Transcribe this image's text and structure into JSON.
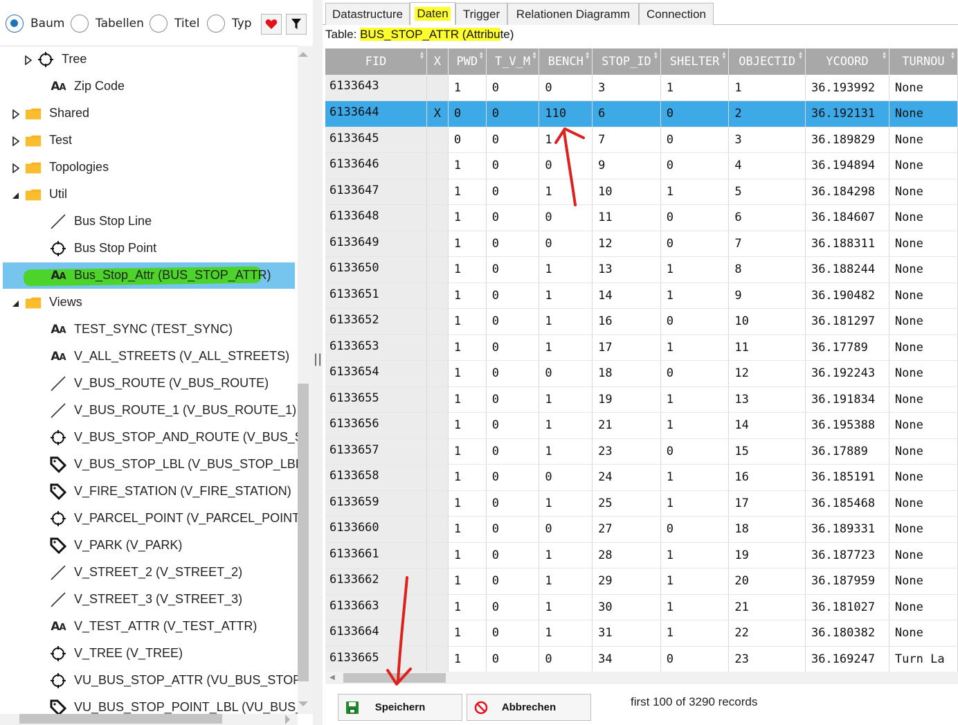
{
  "filter": {
    "radios": [
      {
        "label": "Baum",
        "selected": true
      },
      {
        "label": "Tabellen",
        "selected": false
      },
      {
        "label": "Titel",
        "selected": false
      },
      {
        "label": "Typ",
        "selected": false
      }
    ]
  },
  "tree": {
    "items": [
      {
        "label": "Tree",
        "icon": "crosshair-icon",
        "expander": "collapsed"
      },
      {
        "label": "Zip Code",
        "icon": "attribute-aa-icon",
        "expander": "none"
      },
      {
        "label": "Shared",
        "icon": "folder-icon",
        "expander": "collapsed"
      },
      {
        "label": "Test",
        "icon": "folder-icon",
        "expander": "collapsed"
      },
      {
        "label": "Topologies",
        "icon": "folder-icon",
        "expander": "collapsed"
      },
      {
        "label": "Util",
        "icon": "folder-icon",
        "expander": "expanded"
      },
      {
        "label": "Bus Stop Line",
        "icon": "line-icon",
        "expander": "none"
      },
      {
        "label": "Bus Stop Point",
        "icon": "crosshair-icon",
        "expander": "none"
      },
      {
        "label": "Bus_Stop_Attr (BUS_STOP_ATTR)",
        "icon": "attribute-aa-icon",
        "expander": "none",
        "selected": true
      },
      {
        "label": "Views",
        "icon": "folder-icon",
        "expander": "expanded"
      },
      {
        "label": "TEST_SYNC (TEST_SYNC)",
        "icon": "attribute-aa-icon",
        "expander": "none"
      },
      {
        "label": "V_ALL_STREETS (V_ALL_STREETS)",
        "icon": "attribute-aa-icon",
        "expander": "none"
      },
      {
        "label": "V_BUS_ROUTE (V_BUS_ROUTE)",
        "icon": "line-icon",
        "expander": "none"
      },
      {
        "label": "V_BUS_ROUTE_1 (V_BUS_ROUTE_1)",
        "icon": "line-icon",
        "expander": "none"
      },
      {
        "label": "V_BUS_STOP_AND_ROUTE (V_BUS_STOP_",
        "icon": "crosshair-icon",
        "expander": "none"
      },
      {
        "label": "V_BUS_STOP_LBL (V_BUS_STOP_LBL)",
        "icon": "tag-icon",
        "expander": "none"
      },
      {
        "label": "V_FIRE_STATION (V_FIRE_STATION)",
        "icon": "tag-icon",
        "expander": "none"
      },
      {
        "label": "V_PARCEL_POINT (V_PARCEL_POINT)",
        "icon": "crosshair-icon",
        "expander": "none"
      },
      {
        "label": "V_PARK (V_PARK)",
        "icon": "tag-icon",
        "expander": "none"
      },
      {
        "label": "V_STREET_2 (V_STREET_2)",
        "icon": "line-icon",
        "expander": "none"
      },
      {
        "label": "V_STREET_3 (V_STREET_3)",
        "icon": "line-icon",
        "expander": "none"
      },
      {
        "label": "V_TEST_ATTR (V_TEST_ATTR)",
        "icon": "attribute-aa-icon",
        "expander": "none"
      },
      {
        "label": "V_TREE (V_TREE)",
        "icon": "crosshair-icon",
        "expander": "none"
      },
      {
        "label": "VU_BUS_STOP_ATTR (VU_BUS_STOP_ATT",
        "icon": "crosshair-icon",
        "expander": "none"
      },
      {
        "label": "VU_BUS_STOP_POINT_LBL (VU_BUS_STO",
        "icon": "tag-icon",
        "expander": "none"
      }
    ]
  },
  "tabs": [
    {
      "label": "Datastructure",
      "active": false
    },
    {
      "label": "Daten",
      "active": true
    },
    {
      "label": "Trigger",
      "active": false
    },
    {
      "label": "Relationen Diagramm",
      "active": false
    },
    {
      "label": "Connection",
      "active": false
    }
  ],
  "table_caption": {
    "prefix": "Table: ",
    "highlighted": "BUS_STOP_ATTR (Attribu",
    "suffix": "te)"
  },
  "grid": {
    "columns": [
      "FID",
      "X",
      "PWD",
      "T_V_M",
      "BENCH",
      "STOP_ID",
      "SHELTER",
      "OBJECTID",
      "YCOORD",
      "TURNOU"
    ],
    "rows": [
      [
        "6133643",
        "",
        "1",
        "0",
        "0",
        "3",
        "1",
        "1",
        "36.193992",
        "None"
      ],
      [
        "6133644",
        "X",
        "0",
        "0",
        "110",
        "6",
        "0",
        "2",
        "36.192131",
        "None"
      ],
      [
        "6133645",
        "",
        "0",
        "0",
        "1",
        "7",
        "0",
        "3",
        "36.189829",
        "None"
      ],
      [
        "6133646",
        "",
        "1",
        "0",
        "0",
        "9",
        "0",
        "4",
        "36.194894",
        "None"
      ],
      [
        "6133647",
        "",
        "1",
        "0",
        "1",
        "10",
        "1",
        "5",
        "36.184298",
        "None"
      ],
      [
        "6133648",
        "",
        "1",
        "0",
        "0",
        "11",
        "0",
        "6",
        "36.184607",
        "None"
      ],
      [
        "6133649",
        "",
        "1",
        "0",
        "0",
        "12",
        "0",
        "7",
        "36.188311",
        "None"
      ],
      [
        "6133650",
        "",
        "1",
        "0",
        "1",
        "13",
        "1",
        "8",
        "36.188244",
        "None"
      ],
      [
        "6133651",
        "",
        "1",
        "0",
        "1",
        "14",
        "1",
        "9",
        "36.190482",
        "None"
      ],
      [
        "6133652",
        "",
        "1",
        "0",
        "1",
        "16",
        "0",
        "10",
        "36.181297",
        "None"
      ],
      [
        "6133653",
        "",
        "1",
        "0",
        "1",
        "17",
        "1",
        "11",
        "36.17789",
        "None"
      ],
      [
        "6133654",
        "",
        "1",
        "0",
        "0",
        "18",
        "0",
        "12",
        "36.192243",
        "None"
      ],
      [
        "6133655",
        "",
        "1",
        "0",
        "1",
        "19",
        "1",
        "13",
        "36.191834",
        "None"
      ],
      [
        "6133656",
        "",
        "1",
        "0",
        "1",
        "21",
        "1",
        "14",
        "36.195388",
        "None"
      ],
      [
        "6133657",
        "",
        "1",
        "0",
        "1",
        "23",
        "0",
        "15",
        "36.17889",
        "None"
      ],
      [
        "6133658",
        "",
        "1",
        "0",
        "0",
        "24",
        "1",
        "16",
        "36.185191",
        "None"
      ],
      [
        "6133659",
        "",
        "1",
        "0",
        "1",
        "25",
        "1",
        "17",
        "36.185468",
        "None"
      ],
      [
        "6133660",
        "",
        "1",
        "0",
        "0",
        "27",
        "0",
        "18",
        "36.189331",
        "None"
      ],
      [
        "6133661",
        "",
        "1",
        "0",
        "1",
        "28",
        "1",
        "19",
        "36.187723",
        "None"
      ],
      [
        "6133662",
        "",
        "1",
        "0",
        "1",
        "29",
        "1",
        "20",
        "36.187959",
        "None"
      ],
      [
        "6133663",
        "",
        "1",
        "0",
        "1",
        "30",
        "1",
        "21",
        "36.181027",
        "None"
      ],
      [
        "6133664",
        "",
        "1",
        "0",
        "1",
        "31",
        "1",
        "22",
        "36.180382",
        "None"
      ],
      [
        "6133665",
        "",
        "1",
        "0",
        "0",
        "34",
        "0",
        "23",
        "36.169247",
        "Turn La"
      ]
    ],
    "selected_row": 1
  },
  "buttons": {
    "save": "Speichern",
    "cancel": "Abbrechen"
  },
  "status": {
    "records": "first 100 of 3290 records"
  },
  "splitter_glyph": "||",
  "colors": {
    "selection": "#3ea9e7",
    "tree_selection": "#75c5ee",
    "header": "#a8a8a8",
    "highlight_yellow": "#ffff2e",
    "highlight_green": "#4ad51a",
    "annotation_red": "#e0201b"
  }
}
